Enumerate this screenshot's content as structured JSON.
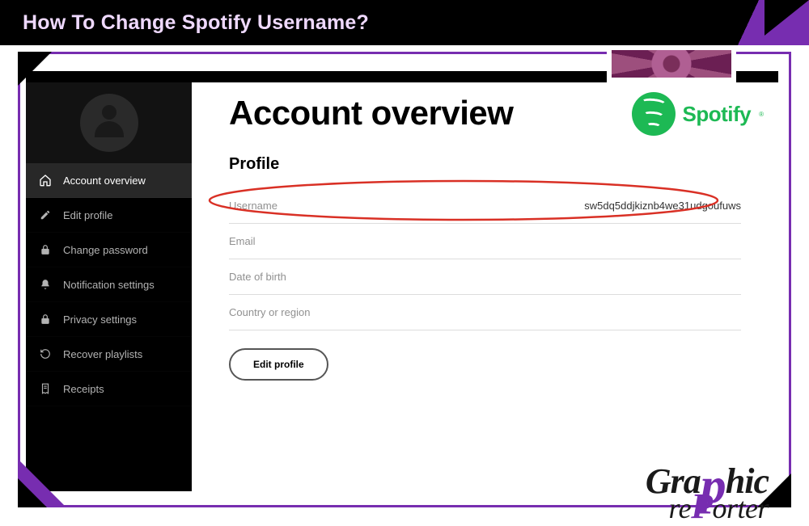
{
  "banner": {
    "title": "How To Change Spotify Username?"
  },
  "sidebar": {
    "items": [
      {
        "label": "Account overview",
        "icon": "home-icon",
        "active": true
      },
      {
        "label": "Edit profile",
        "icon": "pencil-icon",
        "active": false
      },
      {
        "label": "Change password",
        "icon": "lock-icon",
        "active": false
      },
      {
        "label": "Notification settings",
        "icon": "bell-icon",
        "active": false
      },
      {
        "label": "Privacy settings",
        "icon": "lock-icon",
        "active": false
      },
      {
        "label": "Recover playlists",
        "icon": "refresh-icon",
        "active": false
      },
      {
        "label": "Receipts",
        "icon": "receipt-icon",
        "active": false
      }
    ]
  },
  "main": {
    "heading": "Account overview",
    "section": "Profile",
    "fields": [
      {
        "label": "Username",
        "value": "sw5dq5ddjkiznb4we31udgoufuws"
      },
      {
        "label": "Email",
        "value": ""
      },
      {
        "label": "Date of birth",
        "value": ""
      },
      {
        "label": "Country or region",
        "value": ""
      }
    ],
    "edit_button": "Edit profile"
  },
  "brand": {
    "name": "Spotify"
  },
  "watermark": {
    "line1_pre": "Gra",
    "line1_p": "p",
    "line1_post": "hic",
    "line2_pre": "re",
    "line2_p": "P",
    "line2_post": "orter"
  },
  "colors": {
    "accent_purple": "#772db0",
    "spotify_green": "#1db954",
    "highlight_red": "#d93025"
  }
}
